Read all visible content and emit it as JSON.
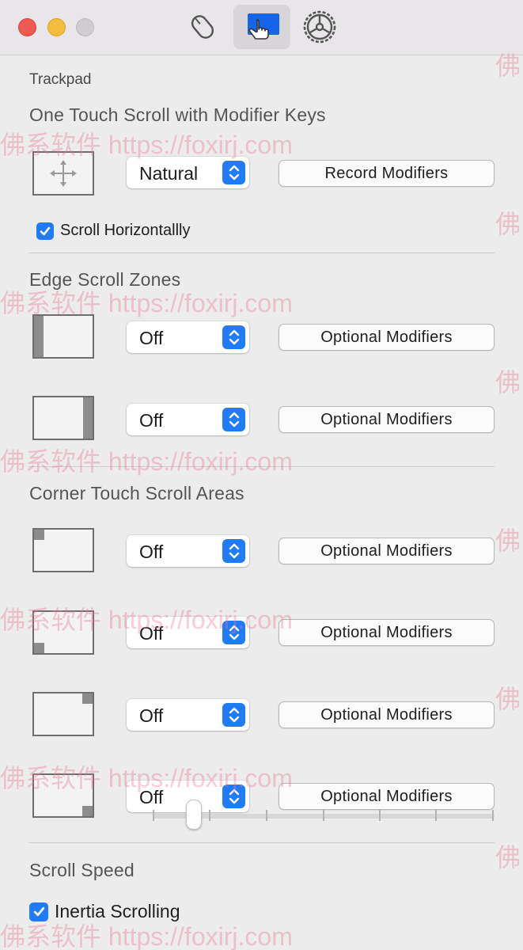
{
  "toolbar": {
    "tabs": [
      {
        "icon": "mouse-icon",
        "selected": false
      },
      {
        "icon": "trackpad-icon",
        "selected": true
      },
      {
        "icon": "gear-icon",
        "selected": false
      }
    ]
  },
  "page": {
    "label": "Trackpad"
  },
  "one_touch": {
    "title": "One Touch Scroll with Modifier Keys",
    "direction_value": "Natural",
    "record_button": "Record Modifiers",
    "scroll_horizontally": {
      "label": "Scroll Horizontallly",
      "checked": true
    }
  },
  "edge": {
    "title": "Edge Scroll Zones",
    "rows": [
      {
        "zone": "left",
        "value": "Off",
        "button": "Optional Modifiers"
      },
      {
        "zone": "right",
        "value": "Off",
        "button": "Optional Modifiers"
      }
    ]
  },
  "corner": {
    "title": "Corner Touch Scroll Areas",
    "rows": [
      {
        "corner": "top-left",
        "value": "Off",
        "button": "Optional Modifiers"
      },
      {
        "corner": "bottom-left",
        "value": "Off",
        "button": "Optional Modifiers"
      },
      {
        "corner": "top-right",
        "value": "Off",
        "button": "Optional Modifiers"
      },
      {
        "corner": "bottom-right",
        "value": "Off",
        "button": "Optional Modifiers"
      }
    ]
  },
  "scroll_speed": {
    "label": "Scroll Speed",
    "value": 0.12,
    "ticks": 7
  },
  "inertia": {
    "label": "Inertia Scrolling",
    "checked": true
  },
  "watermark": {
    "text": "佛系软件 https://foxirj.com",
    "side_text": "佛"
  },
  "colors": {
    "accent": "#1f7bf6",
    "close": "#ee5a52",
    "minimize": "#f5bd3e",
    "zoom": "#cfcdcf"
  }
}
